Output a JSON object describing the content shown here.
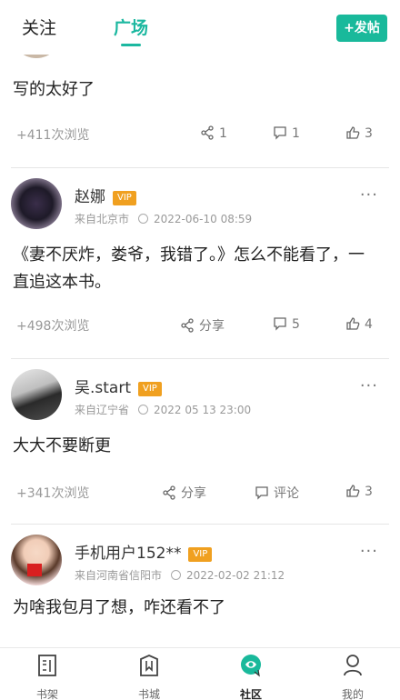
{
  "header": {
    "tabs": [
      {
        "label": "关注"
      },
      {
        "label": "广场"
      }
    ],
    "post_button": "+发帖"
  },
  "posts": [
    {
      "content": "写的太好了",
      "views": "+411次浏览",
      "share": "1",
      "comments": "1",
      "likes": "3"
    },
    {
      "username": "赵娜",
      "vip": "VIP",
      "location": "来自北京市",
      "time": "2022-06-10 08:59",
      "content": "《妻不厌炸，娄爷，我错了。》怎么不能看了，一直追这本书。",
      "views": "+498次浏览",
      "share": "分享",
      "comments": "5",
      "likes": "4"
    },
    {
      "username": "吴.start",
      "vip": "VIP",
      "location": "来自辽宁省",
      "time": "2022 05 13 23:00",
      "content": "大大不要断更",
      "views": "+341次浏览",
      "share": "分享",
      "comments": "评论",
      "likes": "3"
    },
    {
      "username": "手机用户152**",
      "vip": "VIP",
      "location": "来自河南省信阳市",
      "time": "2022-02-02 21:12",
      "content": "为啥我包月了想，咋还看不了"
    }
  ],
  "nav": [
    {
      "label": "书架",
      "icon": "bookshelf-icon"
    },
    {
      "label": "书城",
      "icon": "bookstore-icon"
    },
    {
      "label": "社区",
      "icon": "community-icon"
    },
    {
      "label": "我的",
      "icon": "profile-icon"
    }
  ],
  "colors": {
    "accent": "#19b99b",
    "vip": "#f0a020"
  }
}
